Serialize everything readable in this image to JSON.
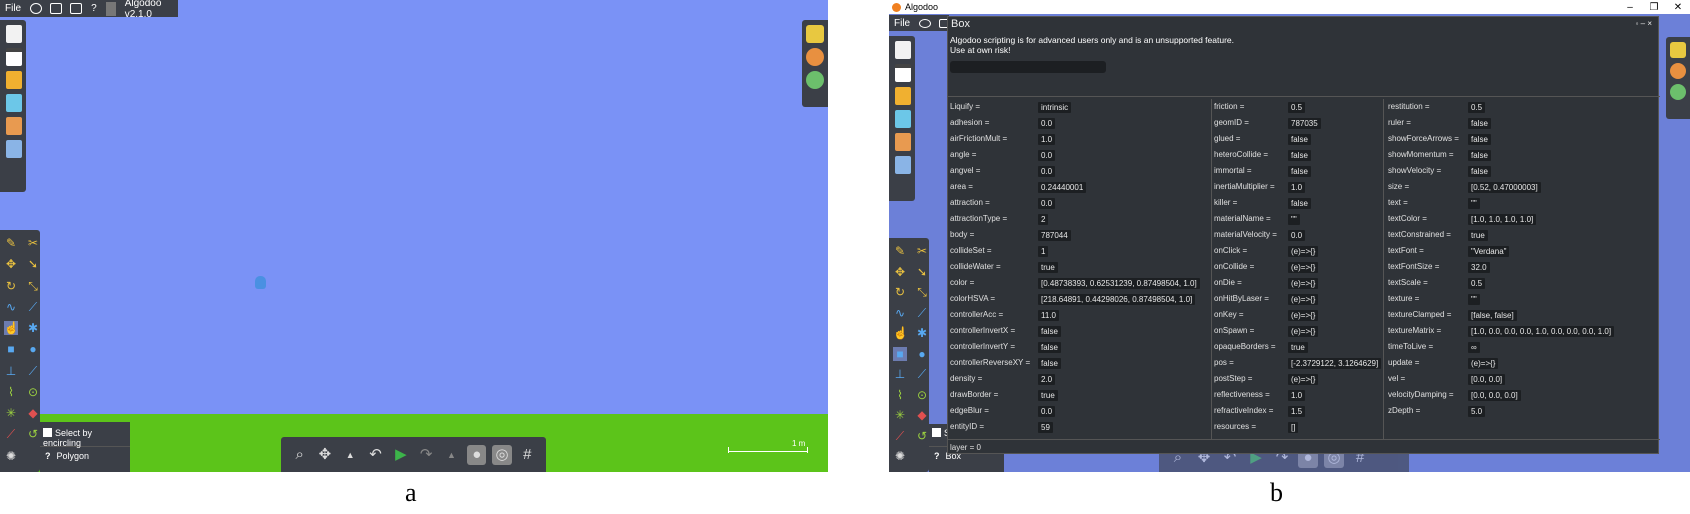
{
  "panel_a": {
    "label": "a",
    "menu": {
      "file": "File",
      "version": "Algodoo v2.1.0"
    },
    "scale_label": "1 m",
    "options": {
      "select_by_encircling": "Select by encircling",
      "polygon": "Polygon",
      "help_glyph": "?"
    }
  },
  "panel_b": {
    "label": "b",
    "titlebar": {
      "app_title": "Algodoo",
      "min": "–",
      "max": "❐",
      "close": "✕"
    },
    "menu": {
      "file": "File"
    },
    "dialog": {
      "title": "Box",
      "controls": "◦ – ×",
      "warning": "Algodoo scripting is for advanced users only and is an unsupported feature. Use at own risk!",
      "footer": "layer = 0",
      "col1": [
        {
          "k": "Liquify =",
          "v": "intrinsic"
        },
        {
          "k": "adhesion =",
          "v": "0.0"
        },
        {
          "k": "airFrictionMult =",
          "v": "1.0"
        },
        {
          "k": "angle =",
          "v": "0.0"
        },
        {
          "k": "angvel =",
          "v": "0.0"
        },
        {
          "k": "area =",
          "v": "0.24440001"
        },
        {
          "k": "attraction =",
          "v": "0.0"
        },
        {
          "k": "attractionType =",
          "v": "2"
        },
        {
          "k": "body =",
          "v": "787044"
        },
        {
          "k": "collideSet =",
          "v": "1"
        },
        {
          "k": "collideWater =",
          "v": "true"
        },
        {
          "k": "color =",
          "v": "[0.48738393, 0.62531239, 0.87498504, 1.0]"
        },
        {
          "k": "colorHSVA =",
          "v": "[218.64891, 0.44298026, 0.87498504, 1.0]"
        },
        {
          "k": "controllerAcc =",
          "v": "11.0"
        },
        {
          "k": "controllerInvertX =",
          "v": "false"
        },
        {
          "k": "controllerInvertY =",
          "v": "false"
        },
        {
          "k": "controllerReverseXY =",
          "v": "false"
        },
        {
          "k": "density =",
          "v": "2.0"
        },
        {
          "k": "drawBorder =",
          "v": "true"
        },
        {
          "k": "edgeBlur =",
          "v": "0.0"
        },
        {
          "k": "entityID =",
          "v": "59"
        }
      ],
      "col2": [
        {
          "k": "friction =",
          "v": "0.5"
        },
        {
          "k": "geomID =",
          "v": "787035"
        },
        {
          "k": "glued =",
          "v": "false"
        },
        {
          "k": "heteroCollide =",
          "v": "false"
        },
        {
          "k": "immortal =",
          "v": "false"
        },
        {
          "k": "inertiaMultiplier =",
          "v": "1.0"
        },
        {
          "k": "killer =",
          "v": "false"
        },
        {
          "k": "materialName =",
          "v": "\"\""
        },
        {
          "k": "materialVelocity =",
          "v": "0.0"
        },
        {
          "k": "onClick =",
          "v": "(e)=>{}"
        },
        {
          "k": "onCollide =",
          "v": "(e)=>{}"
        },
        {
          "k": "onDie =",
          "v": "(e)=>{}"
        },
        {
          "k": "onHitByLaser =",
          "v": "(e)=>{}"
        },
        {
          "k": "onKey =",
          "v": "(e)=>{}"
        },
        {
          "k": "onSpawn =",
          "v": "(e)=>{}"
        },
        {
          "k": "opaqueBorders =",
          "v": "true"
        },
        {
          "k": "pos =",
          "v": "[-2.3729122, 3.1264629]"
        },
        {
          "k": "postStep =",
          "v": "(e)=>{}"
        },
        {
          "k": "reflectiveness =",
          "v": "1.0"
        },
        {
          "k": "refractiveIndex =",
          "v": "1.5"
        },
        {
          "k": "resources =",
          "v": "[]"
        }
      ],
      "col3": [
        {
          "k": "restitution =",
          "v": "0.5"
        },
        {
          "k": "ruler =",
          "v": "false"
        },
        {
          "k": "showForceArrows =",
          "v": "false"
        },
        {
          "k": "showMomentum =",
          "v": "false"
        },
        {
          "k": "showVelocity =",
          "v": "false"
        },
        {
          "k": "size =",
          "v": "[0.52, 0.47000003]"
        },
        {
          "k": "text =",
          "v": "\"\""
        },
        {
          "k": "textColor =",
          "v": "[1.0, 1.0, 1.0, 1.0]"
        },
        {
          "k": "textConstrained =",
          "v": "true"
        },
        {
          "k": "textFont =",
          "v": "\"Verdana\""
        },
        {
          "k": "textFontSize =",
          "v": "32.0"
        },
        {
          "k": "textScale =",
          "v": "0.5"
        },
        {
          "k": "texture =",
          "v": "\"\""
        },
        {
          "k": "textureClamped =",
          "v": "[false, false]"
        },
        {
          "k": "textureMatrix =",
          "v": "[1.0, 0.0, 0.0, 0.0, 1.0, 0.0, 0.0, 0.0, 1.0]"
        },
        {
          "k": "timeToLive =",
          "v": "∞"
        },
        {
          "k": "update =",
          "v": "(e)=>{}"
        },
        {
          "k": "vel =",
          "v": "[0.0, 0.0]"
        },
        {
          "k": "velocityDamping =",
          "v": "[0.0, 0.0, 0.0]"
        },
        {
          "k": "zDepth =",
          "v": "5.0"
        }
      ]
    },
    "options": {
      "select_partial": "Se",
      "box": "Box",
      "help_glyph": "?"
    }
  },
  "colors": {
    "sky": "#7a92f6",
    "ground": "#5cc41a",
    "toolbar": "#3b3f47",
    "dialog": "#2f3338"
  }
}
